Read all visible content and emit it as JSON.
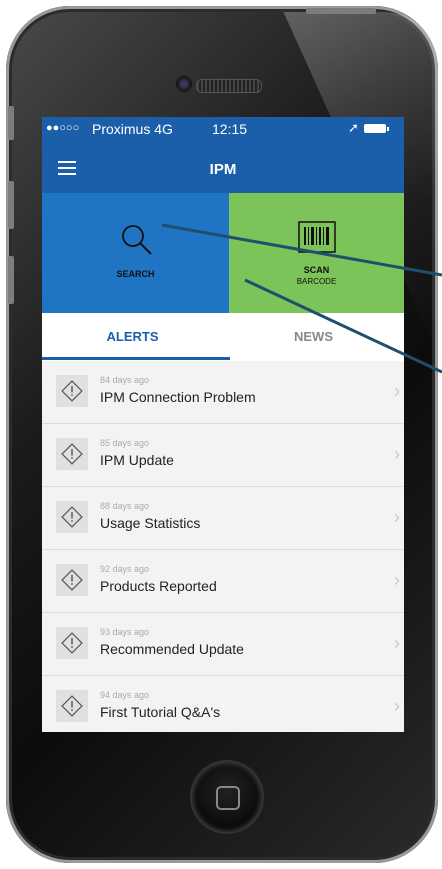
{
  "status_bar": {
    "signal": "●●○○○",
    "carrier": "Proximus  4G",
    "time": "12:15"
  },
  "header": {
    "title": "IPM"
  },
  "tiles": {
    "search_label": "SEARCH",
    "scan_label": "SCAN",
    "scan_sublabel": "BARCODE"
  },
  "tabs": [
    {
      "label": "ALERTS",
      "active": true
    },
    {
      "label": "NEWS",
      "active": false
    }
  ],
  "alerts": [
    {
      "time": "84 days ago",
      "title": "IPM Connection Problem"
    },
    {
      "time": "85 days ago",
      "title": "IPM Update"
    },
    {
      "time": "88 days ago",
      "title": "Usage Statistics"
    },
    {
      "time": "92 days ago",
      "title": "Products Reported"
    },
    {
      "time": "93 days ago",
      "title": "Recommended Update"
    },
    {
      "time": "94 days ago",
      "title": "First Tutorial Q&A's"
    }
  ],
  "colors": {
    "header_blue": "#1b5faa",
    "search_tile": "#1f75c4",
    "scan_tile": "#7cc35a"
  },
  "icons": [
    "menu-icon",
    "search-icon",
    "barcode-icon",
    "alert-icon",
    "chevron-right-icon",
    "location-arrow-icon",
    "battery-icon"
  ]
}
